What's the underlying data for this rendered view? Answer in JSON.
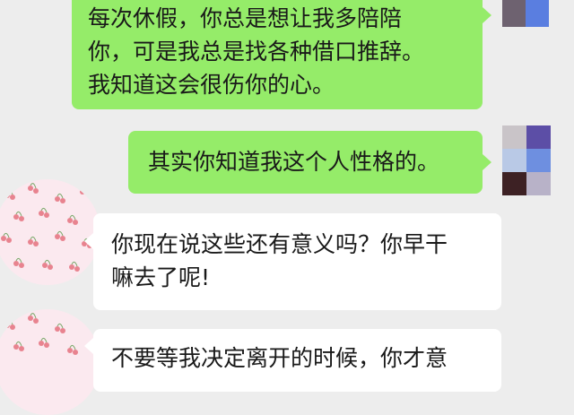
{
  "messages": [
    {
      "side": "out",
      "lines": [
        "每次休假，你总是想让我多陪陪",
        "你，可是我总是找各种借口推辞。",
        "我知道这会很伤你的心。"
      ]
    },
    {
      "side": "out",
      "lines": [
        "其实你知道我这个人性格的。"
      ]
    },
    {
      "side": "in",
      "lines": [
        "你现在说这些还有意义吗？你早干",
        "嘛去了呢!"
      ]
    },
    {
      "side": "in",
      "lines": [
        "不要等我决定离开的时候，你才意"
      ]
    }
  ],
  "colors": {
    "background": "#ededed",
    "outgoing_bubble": "#95ec69",
    "incoming_bubble": "#ffffff",
    "text": "#191919"
  },
  "icons": {
    "self_avatar": "pixel-mosaic-avatar",
    "contact_avatar": "cherry-pattern-avatar"
  }
}
